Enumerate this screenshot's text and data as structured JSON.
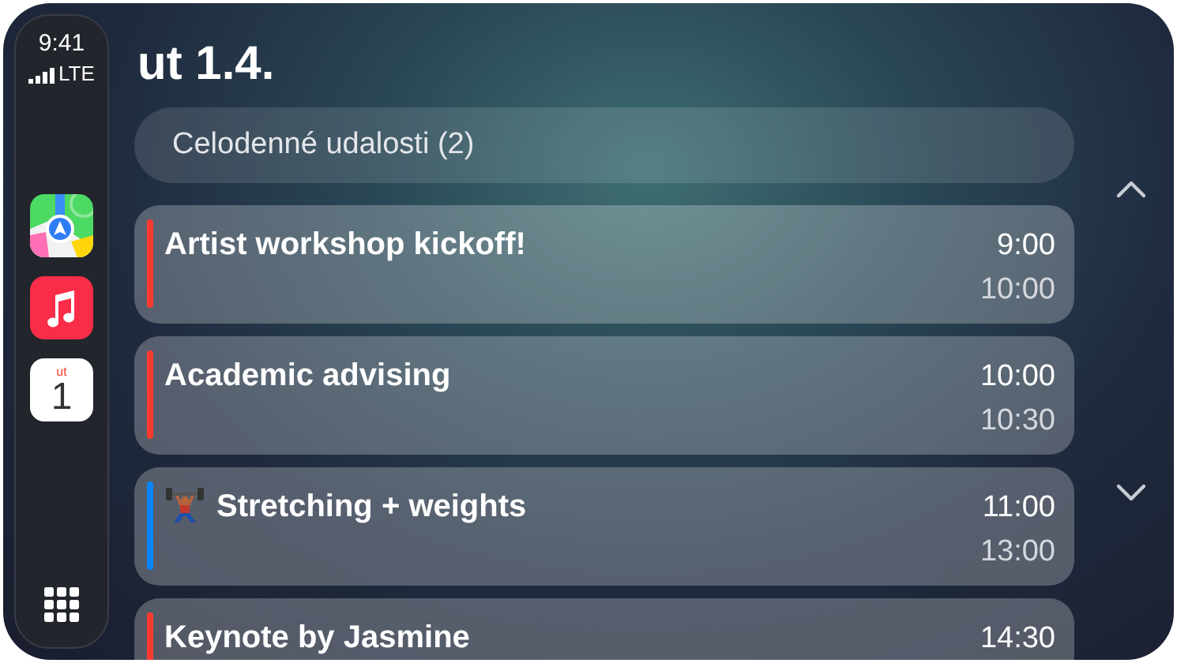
{
  "status": {
    "time": "9:41",
    "network": "LTE"
  },
  "dock": [
    {
      "kind": "maps"
    },
    {
      "kind": "music"
    },
    {
      "kind": "calendar",
      "weekday": "ut",
      "day": "1"
    }
  ],
  "header": {
    "date": "ut 1.4."
  },
  "all_day": {
    "label": "Celodenné udalosti (2)"
  },
  "events": [
    {
      "kind": "plain",
      "title": "Artist workshop kickoff!",
      "start": "9:00",
      "end": "10:00",
      "color": "#ff3b30"
    },
    {
      "kind": "plain",
      "title": "Academic advising",
      "start": "10:00",
      "end": "10:30",
      "color": "#ff3b30"
    },
    {
      "kind": "with_emoji",
      "title": "Stretching + weights",
      "start": "11:00",
      "end": "13:00",
      "color": "#0a84ff"
    },
    {
      "kind": "plain",
      "title": "Keynote by Jasmine",
      "start": "14:30",
      "color": "#ff3b30"
    }
  ]
}
